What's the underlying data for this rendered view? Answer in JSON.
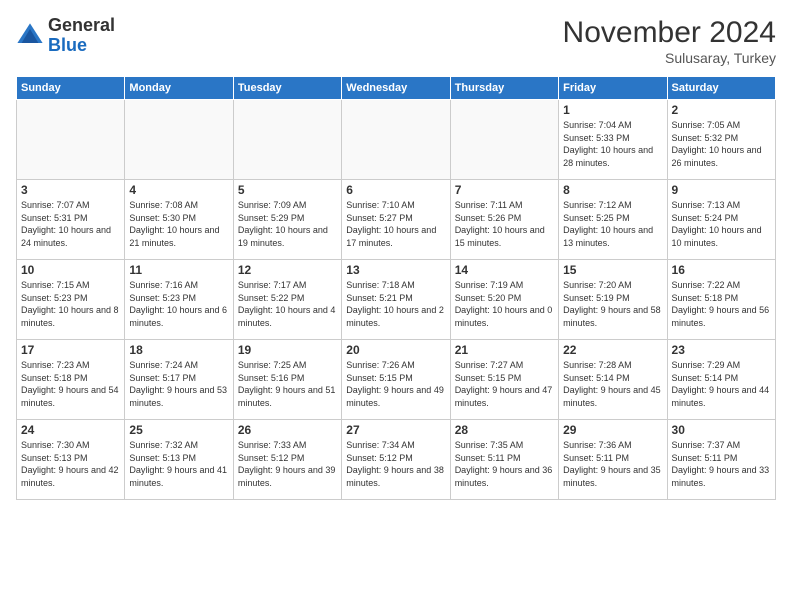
{
  "logo": {
    "general": "General",
    "blue": "Blue"
  },
  "header": {
    "month": "November 2024",
    "location": "Sulusaray, Turkey"
  },
  "weekdays": [
    "Sunday",
    "Monday",
    "Tuesday",
    "Wednesday",
    "Thursday",
    "Friday",
    "Saturday"
  ],
  "weeks": [
    [
      {
        "day": "",
        "info": ""
      },
      {
        "day": "",
        "info": ""
      },
      {
        "day": "",
        "info": ""
      },
      {
        "day": "",
        "info": ""
      },
      {
        "day": "",
        "info": ""
      },
      {
        "day": "1",
        "info": "Sunrise: 7:04 AM\nSunset: 5:33 PM\nDaylight: 10 hours and 28 minutes."
      },
      {
        "day": "2",
        "info": "Sunrise: 7:05 AM\nSunset: 5:32 PM\nDaylight: 10 hours and 26 minutes."
      }
    ],
    [
      {
        "day": "3",
        "info": "Sunrise: 7:07 AM\nSunset: 5:31 PM\nDaylight: 10 hours and 24 minutes."
      },
      {
        "day": "4",
        "info": "Sunrise: 7:08 AM\nSunset: 5:30 PM\nDaylight: 10 hours and 21 minutes."
      },
      {
        "day": "5",
        "info": "Sunrise: 7:09 AM\nSunset: 5:29 PM\nDaylight: 10 hours and 19 minutes."
      },
      {
        "day": "6",
        "info": "Sunrise: 7:10 AM\nSunset: 5:27 PM\nDaylight: 10 hours and 17 minutes."
      },
      {
        "day": "7",
        "info": "Sunrise: 7:11 AM\nSunset: 5:26 PM\nDaylight: 10 hours and 15 minutes."
      },
      {
        "day": "8",
        "info": "Sunrise: 7:12 AM\nSunset: 5:25 PM\nDaylight: 10 hours and 13 minutes."
      },
      {
        "day": "9",
        "info": "Sunrise: 7:13 AM\nSunset: 5:24 PM\nDaylight: 10 hours and 10 minutes."
      }
    ],
    [
      {
        "day": "10",
        "info": "Sunrise: 7:15 AM\nSunset: 5:23 PM\nDaylight: 10 hours and 8 minutes."
      },
      {
        "day": "11",
        "info": "Sunrise: 7:16 AM\nSunset: 5:23 PM\nDaylight: 10 hours and 6 minutes."
      },
      {
        "day": "12",
        "info": "Sunrise: 7:17 AM\nSunset: 5:22 PM\nDaylight: 10 hours and 4 minutes."
      },
      {
        "day": "13",
        "info": "Sunrise: 7:18 AM\nSunset: 5:21 PM\nDaylight: 10 hours and 2 minutes."
      },
      {
        "day": "14",
        "info": "Sunrise: 7:19 AM\nSunset: 5:20 PM\nDaylight: 10 hours and 0 minutes."
      },
      {
        "day": "15",
        "info": "Sunrise: 7:20 AM\nSunset: 5:19 PM\nDaylight: 9 hours and 58 minutes."
      },
      {
        "day": "16",
        "info": "Sunrise: 7:22 AM\nSunset: 5:18 PM\nDaylight: 9 hours and 56 minutes."
      }
    ],
    [
      {
        "day": "17",
        "info": "Sunrise: 7:23 AM\nSunset: 5:18 PM\nDaylight: 9 hours and 54 minutes."
      },
      {
        "day": "18",
        "info": "Sunrise: 7:24 AM\nSunset: 5:17 PM\nDaylight: 9 hours and 53 minutes."
      },
      {
        "day": "19",
        "info": "Sunrise: 7:25 AM\nSunset: 5:16 PM\nDaylight: 9 hours and 51 minutes."
      },
      {
        "day": "20",
        "info": "Sunrise: 7:26 AM\nSunset: 5:15 PM\nDaylight: 9 hours and 49 minutes."
      },
      {
        "day": "21",
        "info": "Sunrise: 7:27 AM\nSunset: 5:15 PM\nDaylight: 9 hours and 47 minutes."
      },
      {
        "day": "22",
        "info": "Sunrise: 7:28 AM\nSunset: 5:14 PM\nDaylight: 9 hours and 45 minutes."
      },
      {
        "day": "23",
        "info": "Sunrise: 7:29 AM\nSunset: 5:14 PM\nDaylight: 9 hours and 44 minutes."
      }
    ],
    [
      {
        "day": "24",
        "info": "Sunrise: 7:30 AM\nSunset: 5:13 PM\nDaylight: 9 hours and 42 minutes."
      },
      {
        "day": "25",
        "info": "Sunrise: 7:32 AM\nSunset: 5:13 PM\nDaylight: 9 hours and 41 minutes."
      },
      {
        "day": "26",
        "info": "Sunrise: 7:33 AM\nSunset: 5:12 PM\nDaylight: 9 hours and 39 minutes."
      },
      {
        "day": "27",
        "info": "Sunrise: 7:34 AM\nSunset: 5:12 PM\nDaylight: 9 hours and 38 minutes."
      },
      {
        "day": "28",
        "info": "Sunrise: 7:35 AM\nSunset: 5:11 PM\nDaylight: 9 hours and 36 minutes."
      },
      {
        "day": "29",
        "info": "Sunrise: 7:36 AM\nSunset: 5:11 PM\nDaylight: 9 hours and 35 minutes."
      },
      {
        "day": "30",
        "info": "Sunrise: 7:37 AM\nSunset: 5:11 PM\nDaylight: 9 hours and 33 minutes."
      }
    ]
  ]
}
